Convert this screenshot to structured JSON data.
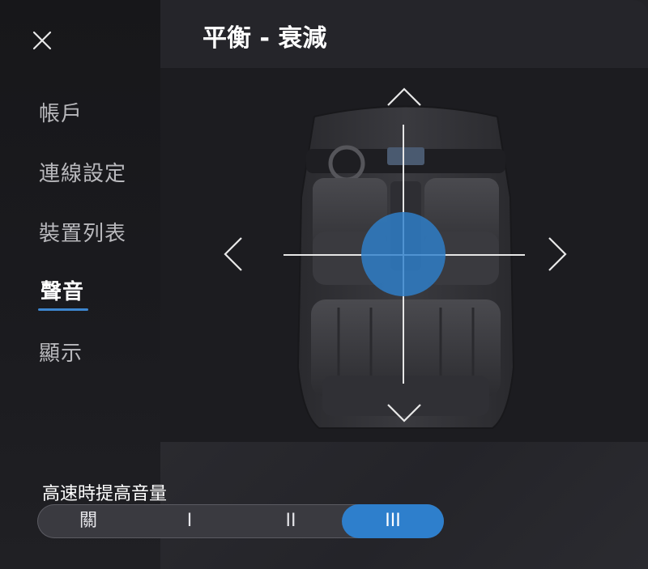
{
  "sidebar": {
    "close_icon": "close-icon",
    "items": [
      {
        "label": "帳戶"
      },
      {
        "label": "連線設定"
      },
      {
        "label": "裝置列表"
      },
      {
        "label": "聲音",
        "active": true
      },
      {
        "label": "顯示"
      }
    ]
  },
  "header": {
    "title": "平衡 - 衰減"
  },
  "balance_fade": {
    "arrows": [
      "chevron-up-icon",
      "chevron-down-icon",
      "chevron-left-icon",
      "chevron-right-icon"
    ],
    "accent_color": "#2e80cc"
  },
  "speed_volume": {
    "label": "高速時提高音量",
    "options": [
      "關",
      "I",
      "II",
      "III"
    ],
    "selected": "III"
  }
}
